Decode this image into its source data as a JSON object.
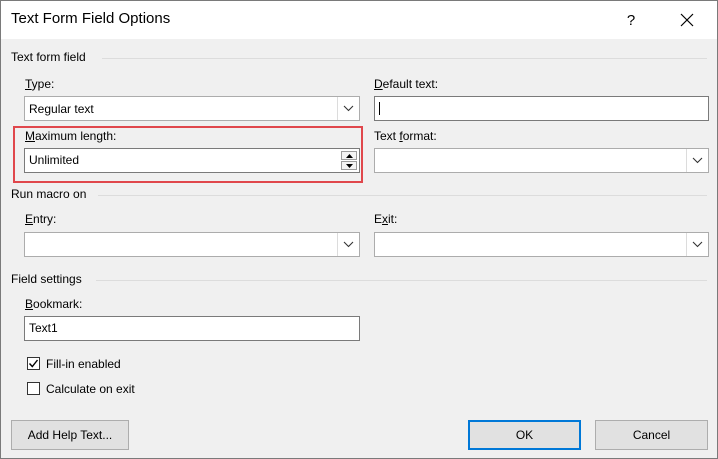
{
  "dialog": {
    "title": "Text Form Field Options",
    "help_glyph": "?"
  },
  "text_form_field": {
    "group_label": "Text form field",
    "type": {
      "label": "Type:",
      "value": "Regular text"
    },
    "default_text": {
      "label": "Default text:",
      "value": ""
    },
    "max_length": {
      "label": "Maximum length:",
      "value": "Unlimited"
    },
    "text_format": {
      "label": "Text format:",
      "value": ""
    }
  },
  "run_macro": {
    "group_label": "Run macro on",
    "entry": {
      "label": "Entry:",
      "value": ""
    },
    "exit": {
      "label": "Exit:",
      "value": ""
    }
  },
  "field_settings": {
    "group_label": "Field settings",
    "bookmark": {
      "label": "Bookmark:",
      "value": "Text1"
    },
    "fill_in": {
      "label": "Fill-in enabled",
      "checked": true
    },
    "calculate": {
      "label": "Calculate on exit",
      "checked": false
    }
  },
  "buttons": {
    "add_help": "Add Help Text...",
    "ok": "OK",
    "cancel": "Cancel"
  },
  "colors": {
    "highlight": "#e0474c",
    "default_button_border": "#0078d7"
  }
}
